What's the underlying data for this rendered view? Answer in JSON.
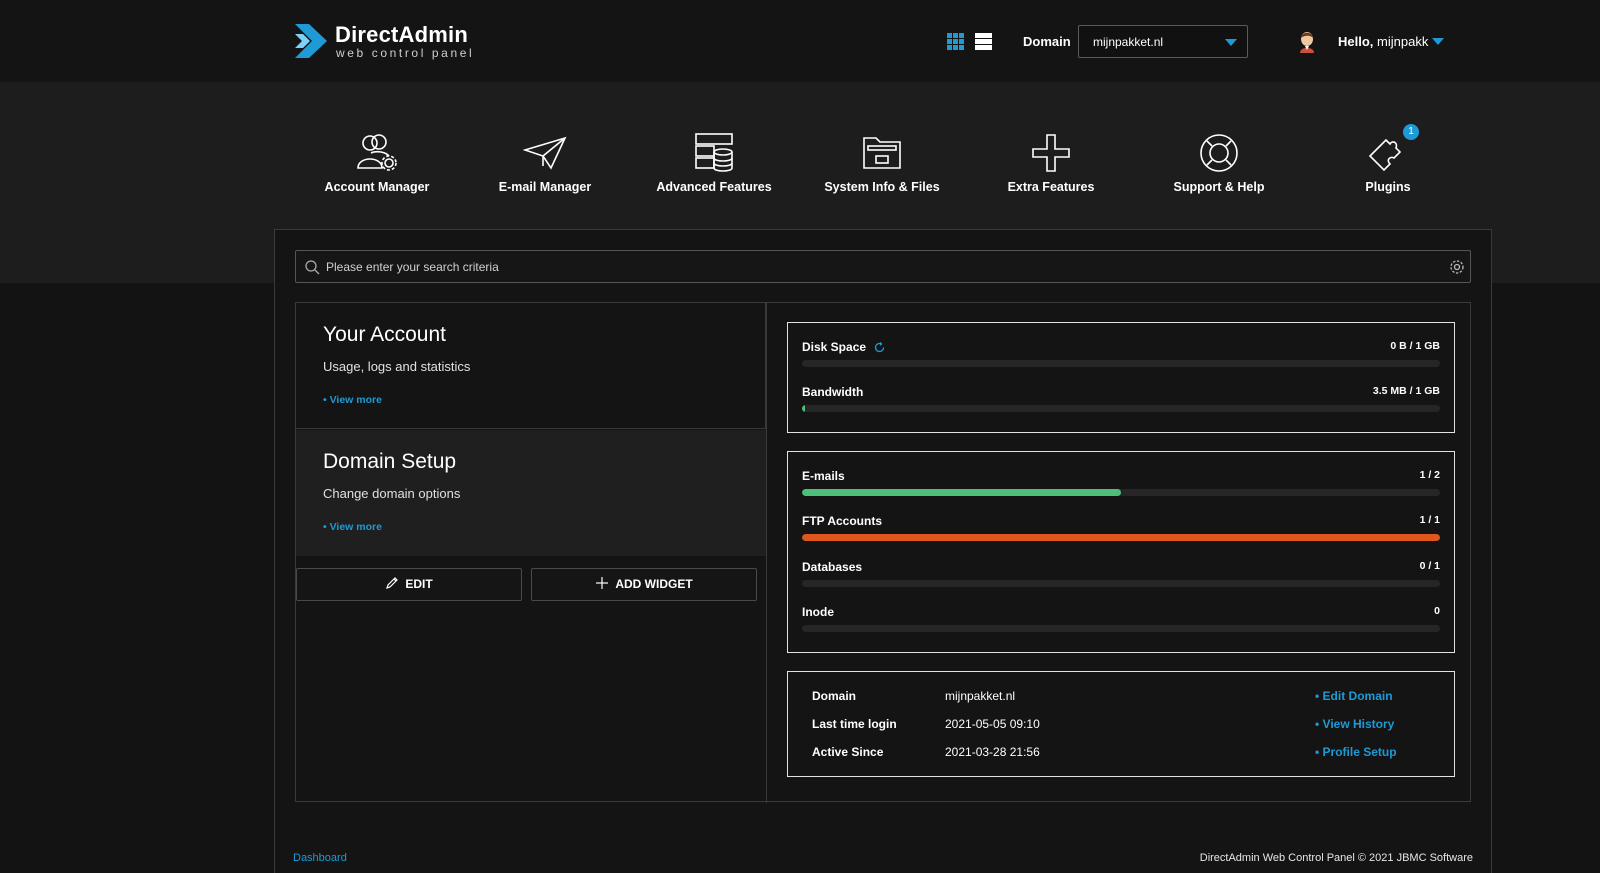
{
  "brand": {
    "title": "DirectAdmin",
    "subtitle": "web control panel"
  },
  "header": {
    "view_grid_icon": "grid-view-icon",
    "view_list_icon": "list-view-icon",
    "domain_label": "Domain",
    "domain_value": "mijnpakket.nl",
    "hello_prefix": "Hello,",
    "username": "mijnpakk"
  },
  "nav": [
    {
      "label": "Account Manager",
      "icon": "account-manager-icon"
    },
    {
      "label": "E-mail Manager",
      "icon": "paper-plane-icon"
    },
    {
      "label": "Advanced Features",
      "icon": "server-database-icon"
    },
    {
      "label": "System Info & Files",
      "icon": "folder-icon"
    },
    {
      "label": "Extra Features",
      "icon": "plus-icon"
    },
    {
      "label": "Support & Help",
      "icon": "lifebuoy-icon"
    },
    {
      "label": "Plugins",
      "icon": "puzzle-icon",
      "badge": "1"
    }
  ],
  "search": {
    "placeholder": "Please enter your search criteria"
  },
  "widgets": [
    {
      "title": "Your Account",
      "desc": "Usage, logs and statistics",
      "link": "• View more"
    },
    {
      "title": "Domain Setup",
      "desc": "Change domain options",
      "link": "• View more"
    }
  ],
  "buttons": {
    "edit": "EDIT",
    "add_widget": "ADD WIDGET"
  },
  "usage": [
    {
      "name": "Disk Space",
      "value": "0 B / 1 GB",
      "fraction": 0,
      "color": "#4cc07a"
    },
    {
      "name": "Bandwidth",
      "value": "3.5 MB / 1 GB",
      "fraction": 0.0035,
      "color": "#4cc07a"
    }
  ],
  "counts": [
    {
      "name": "E-mails",
      "value": "1 / 2",
      "fraction": 0.5,
      "color": "#4cc07a"
    },
    {
      "name": "FTP Accounts",
      "value": "1 / 1",
      "fraction": 1.0,
      "color": "#e0561f"
    },
    {
      "name": "Databases",
      "value": "0 / 1",
      "fraction": 0,
      "color": "#4cc07a"
    },
    {
      "name": "Inode",
      "value": "0",
      "fraction": 0,
      "color": "#4cc07a"
    }
  ],
  "info": [
    {
      "label": "Domain",
      "value": "mijnpakket.nl",
      "link": "• Edit Domain"
    },
    {
      "label": "Last time login",
      "value": "2021-05-05 09:10",
      "link": "• View History"
    },
    {
      "label": "Active Since",
      "value": "2021-03-28 21:56",
      "link": "• Profile Setup"
    }
  ],
  "footer": {
    "breadcrumb": "Dashboard",
    "copyright": "DirectAdmin Web Control Panel © 2021 JBMC Software"
  },
  "colors": {
    "accent": "#1e9ad6",
    "background": "#131313",
    "band": "#1d1d1d",
    "ok": "#4cc07a",
    "full": "#e0561f"
  }
}
